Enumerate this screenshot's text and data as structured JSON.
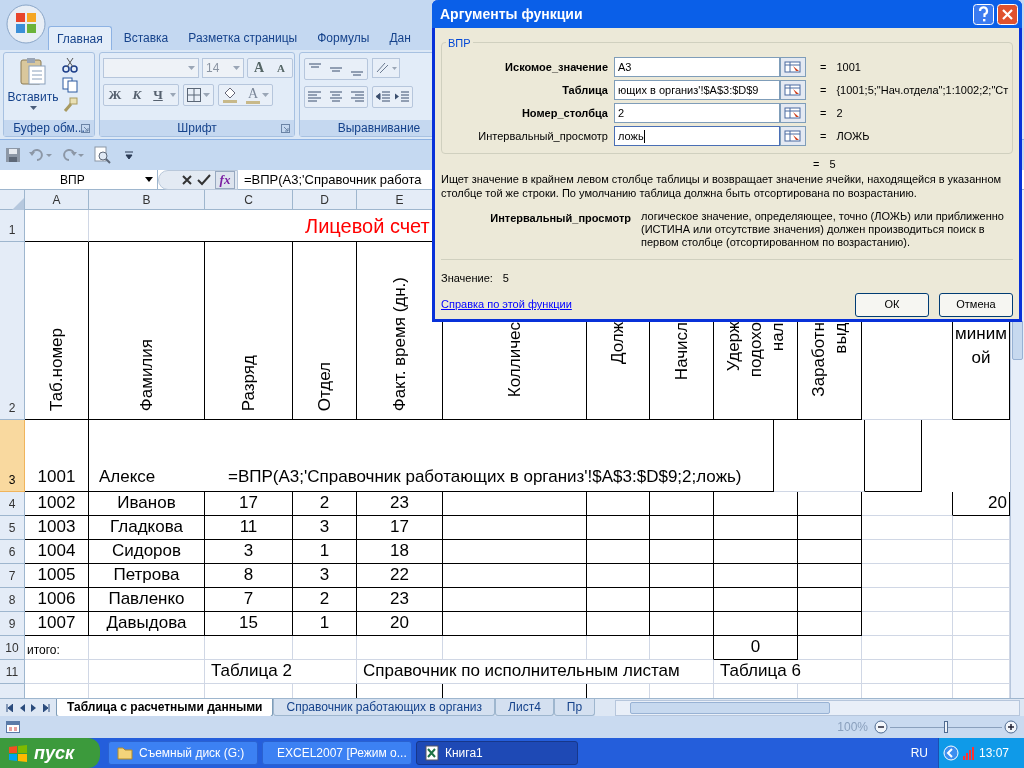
{
  "ribbon": {
    "tabs": [
      {
        "label": "Главная",
        "selected": true
      },
      {
        "label": "Вставка",
        "selected": false
      },
      {
        "label": "Разметка страницы",
        "selected": false
      },
      {
        "label": "Формулы",
        "selected": false
      },
      {
        "label": "Дан",
        "selected": false
      }
    ],
    "clipboard": {
      "paste_label": "Вставить",
      "group_label": "Буфер обм..."
    },
    "font": {
      "size": "14",
      "grow": "A",
      "shrink": "A",
      "bold": "Ж",
      "italic": "К",
      "underline": "Ч",
      "text_color_button": "A",
      "group_label": "Шрифт"
    },
    "alignment": {
      "group_label": "Выравнивание"
    }
  },
  "formula_bar": {
    "name_box": "ВПР",
    "fx": "fx",
    "formula": "=ВПР(A3;'Справочник работа"
  },
  "sheet": {
    "column_headers": [
      "A",
      "B",
      "C",
      "D",
      "E"
    ],
    "rows": [
      {
        "number": "1",
        "selected": false,
        "title": "Лицевой счет"
      },
      {
        "number": "2",
        "selected": false,
        "cells": {
          "A": "Таб.номер",
          "B": "Фамилия",
          "C": "Разряд",
          "D": "Отдел",
          "E": "Факт. время (дн.)",
          "F": "Колличес",
          "G": "Долж",
          "H": "Начисл",
          "I": "Удерж\nподохо\nнал",
          "J": "Заработн\nвыд",
          "L": "миним\nой"
        }
      },
      {
        "number": "3",
        "selected": true,
        "cells": {
          "A": "1001",
          "B": "Алексе"
        },
        "edit": "=ВПР(A3;'Справочник работающих в организ'!$A$3:$D$9;2;ложь)"
      },
      {
        "number": "4",
        "selected": false,
        "cells": {
          "A": "1002",
          "B": "Иванов",
          "C": "17",
          "D": "2",
          "E": "23",
          "L": "20"
        }
      },
      {
        "number": "5",
        "selected": false,
        "cells": {
          "A": "1003",
          "B": "Гладкова",
          "C": "11",
          "D": "3",
          "E": "17"
        }
      },
      {
        "number": "6",
        "selected": false,
        "cells": {
          "A": "1004",
          "B": "Сидоров",
          "C": "3",
          "D": "1",
          "E": "18"
        }
      },
      {
        "number": "7",
        "selected": false,
        "cells": {
          "A": "1005",
          "B": "Петрова",
          "C": "8",
          "D": "3",
          "E": "22"
        }
      },
      {
        "number": "8",
        "selected": false,
        "cells": {
          "A": "1006",
          "B": "Павленко",
          "C": "7",
          "D": "2",
          "E": "23"
        }
      },
      {
        "number": "9",
        "selected": false,
        "cells": {
          "A": "1007",
          "B": "Давыдова",
          "C": "15",
          "D": "1",
          "E": "20"
        }
      },
      {
        "number": "10",
        "selected": false,
        "cells": {
          "A": "итого:",
          "I": "0"
        }
      },
      {
        "number": "11",
        "selected": false,
        "cells": {
          "C": "Таблица 2",
          "E": "Справочник по исполнительным листам",
          "I": "Таблица 6"
        }
      }
    ]
  },
  "sheet_tabs": [
    {
      "label": "Таблица с расчетными данными",
      "selected": true
    },
    {
      "label": "Справочник работающих в организ",
      "selected": false
    },
    {
      "label": "Лист4",
      "selected": false
    },
    {
      "label": "Пр",
      "selected": false
    }
  ],
  "zoom": {
    "label": "100%",
    "level": 0.5
  },
  "dialog": {
    "title": "Аргументы функции",
    "function": "ВПР",
    "args": [
      {
        "label": "Искомое_значение",
        "required": true,
        "value": "A3",
        "result": "1001",
        "focused": false
      },
      {
        "label": "Таблица",
        "required": true,
        "value": "ющих в организ'!$A$3:$D$9",
        "result": "{1001;5;\"Нач.отдела\";1:1002;2;\"Ст",
        "focused": false
      },
      {
        "label": "Номер_столбца",
        "required": true,
        "value": "2",
        "result": "2",
        "focused": false
      },
      {
        "label": "Интервальный_просмотр",
        "required": false,
        "value": "ложь",
        "result": "ЛОЖЬ",
        "focused": true
      }
    ],
    "equals": "=",
    "formula_result": "5",
    "description": "Ищет значение в крайнем левом столбце таблицы и возвращает значение ячейки, находящейся в указанном столбце той же строки. По умолчанию таблица должна быть отсортирована по возрастанию.",
    "arg_help_label": "Интервальный_просмотр",
    "arg_help_text": "логическое значение, определяющее, точно (ЛОЖЬ) или приближенно (ИСТИНА или отсутствие значения) должен производиться поиск в первом столбце (отсортированном по возрастанию).",
    "value_label": "Значение:",
    "value": "5",
    "help_link": "Справка по этой функции",
    "ok": "ОК",
    "cancel": "Отмена"
  },
  "taskbar": {
    "start": "пуск",
    "items": [
      {
        "label": "Съемный диск (G:)",
        "kind": "folder",
        "selected": false
      },
      {
        "label": "EXCEL2007 [Режим о...",
        "kind": "document",
        "selected": false
      },
      {
        "label": "Книга1",
        "kind": "sheet",
        "selected": true
      }
    ],
    "language": "RU",
    "clock": "13:07"
  }
}
